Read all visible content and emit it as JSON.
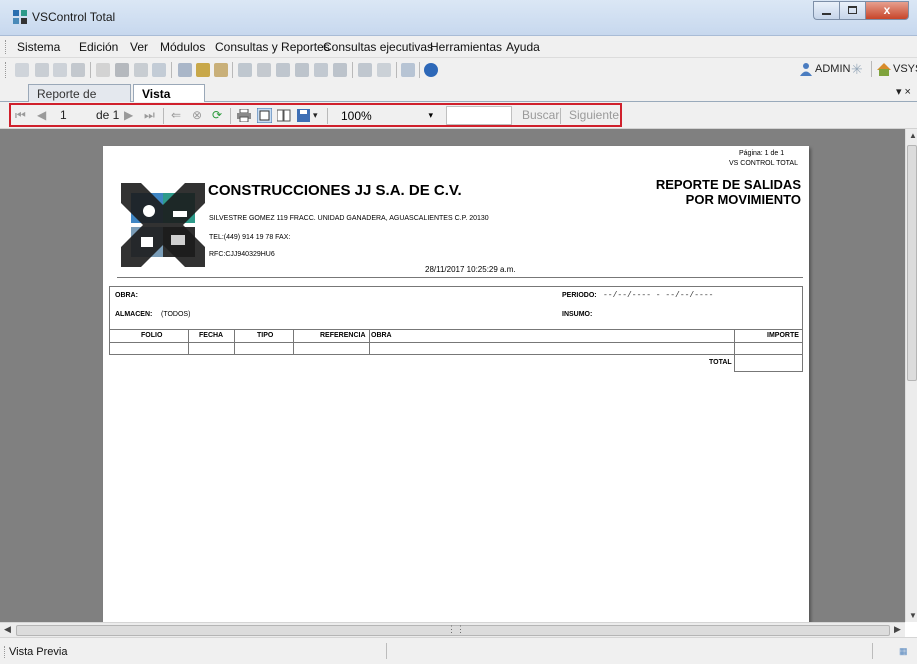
{
  "window": {
    "title": "VSControl Total",
    "close_glyph": "x"
  },
  "menu": [
    "Sistema",
    "Edición",
    "Ver",
    "Módulos",
    "Consultas y Reportes",
    "Consultas ejecutivas",
    "Herramientas",
    "Ayuda"
  ],
  "toolbar": {
    "icons": [
      "new-icon",
      "open-icon",
      "save-icon",
      "save-all-icon",
      "find-icon",
      "print-icon",
      "export-icon",
      "email-icon",
      "cut-icon",
      "copy-icon",
      "paste-icon",
      "filter-icon",
      "grid-icon",
      "sort-icon",
      "group-icon",
      "format-icon",
      "columns-icon",
      "layout-icon",
      "mail-icon",
      "help-icon"
    ],
    "user_label": "ADMIN",
    "company_label": "VSYS"
  },
  "tabs": [
    {
      "label": "Reporte de salidas",
      "active": false
    },
    {
      "label": "Vista Previa",
      "active": true
    }
  ],
  "tab_controls": "▾ ×",
  "preview_toolbar": {
    "current_page": "1",
    "page_of": "de 1",
    "zoom": "100%",
    "search_label": "Buscar",
    "next_label": "Siguiente"
  },
  "report": {
    "page_label": "Página: 1 de 1",
    "system_name": "VS CONTROL TOTAL",
    "company_name": "CONSTRUCCIONES JJ S.A.  DE C.V.",
    "address": "SILVESTRE GOMEZ 119 FRACC. UNIDAD GANADERA, AGUASCALIENTES C.P. 20130",
    "phone": "TEL:(449) 914 19 78   FAX:",
    "rfc": "RFC:CJJ940329HU6",
    "title_line1": "REPORTE DE SALIDAS",
    "title_line2": "POR MOVIMIENTO",
    "datetime": "28/11/2017  10:25:29 a.m.",
    "obra_label": "OBRA:",
    "almacen_label": "ALMACEN:",
    "almacen_value": "(TODOS)",
    "periodo_label": "PERIODO:",
    "periodo_value": "--/--/----  -  --/--/----",
    "insumo_label": "INSUMO:",
    "columns": [
      "FOLIO",
      "FECHA",
      "TIPO",
      "REFERENCIA",
      "OBRA",
      "IMPORTE"
    ],
    "total_label": "TOTAL"
  },
  "status": {
    "text": "Vista Previa"
  },
  "colors": {
    "highlight": "#d0202c",
    "preview_bg": "#808080"
  }
}
